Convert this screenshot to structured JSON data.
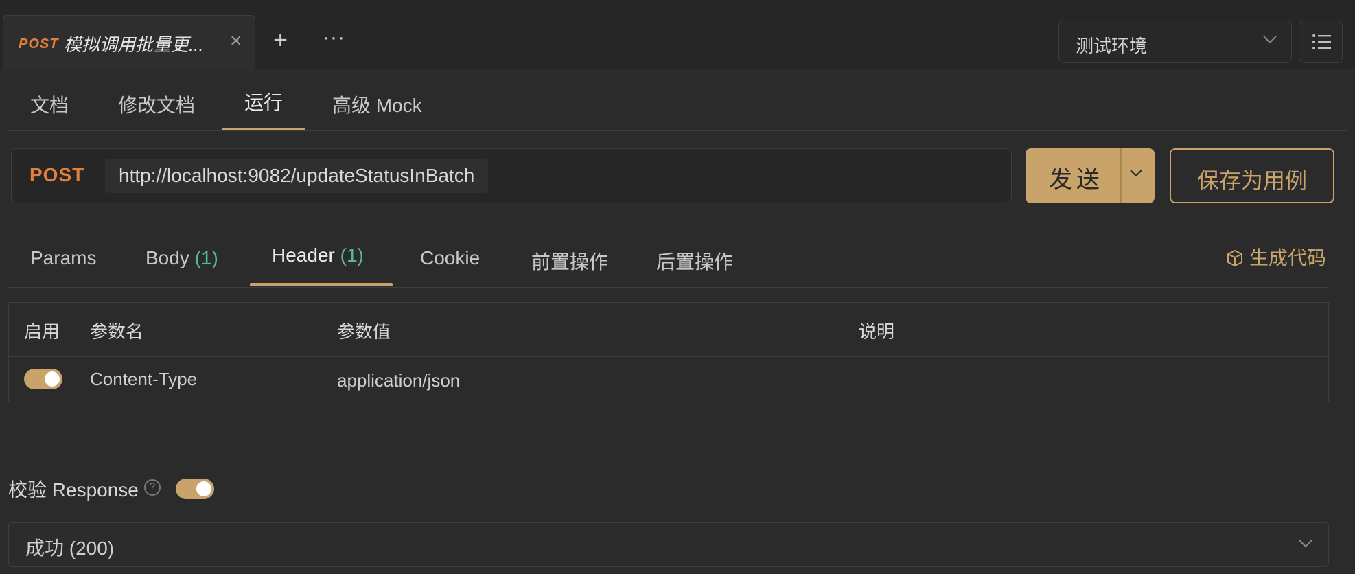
{
  "request_tab": {
    "method": "POST",
    "title": "模拟调用批量更...",
    "close_icon": "×"
  },
  "top_actions": {
    "plus": "+",
    "more": "···"
  },
  "environment": {
    "selected": "测试环境"
  },
  "subtabs": [
    {
      "label": "文档"
    },
    {
      "label": "修改文档"
    },
    {
      "label": "运行",
      "active": true
    },
    {
      "label": "高级 Mock"
    }
  ],
  "urlbar": {
    "method": "POST",
    "url": "http://localhost:9082/updateStatusInBatch"
  },
  "send_button": {
    "label": "发送"
  },
  "save_case_button": {
    "label": "保存为用例"
  },
  "request_tabs": [
    {
      "label": "Params",
      "count": ""
    },
    {
      "label": "Body",
      "count": "(1)"
    },
    {
      "label": "Header",
      "count": "(1)",
      "active": true
    },
    {
      "label": "Cookie",
      "count": ""
    },
    {
      "label": "前置操作",
      "count": ""
    },
    {
      "label": "后置操作",
      "count": ""
    }
  ],
  "generate_code": {
    "label": "生成代码"
  },
  "header_table": {
    "columns": [
      "启用",
      "参数名",
      "参数值",
      "说明"
    ],
    "rows": [
      {
        "enabled": true,
        "name": "Content-Type",
        "value": "application/json",
        "description": ""
      }
    ]
  },
  "verify_response": {
    "label": "校验 Response",
    "help": "?",
    "enabled": true
  },
  "response_select": {
    "selected": "成功 (200)"
  },
  "colors": {
    "accent": "#c9a46a",
    "method": "#e0803a",
    "count": "#57b894",
    "background": "#2b2b2b"
  }
}
